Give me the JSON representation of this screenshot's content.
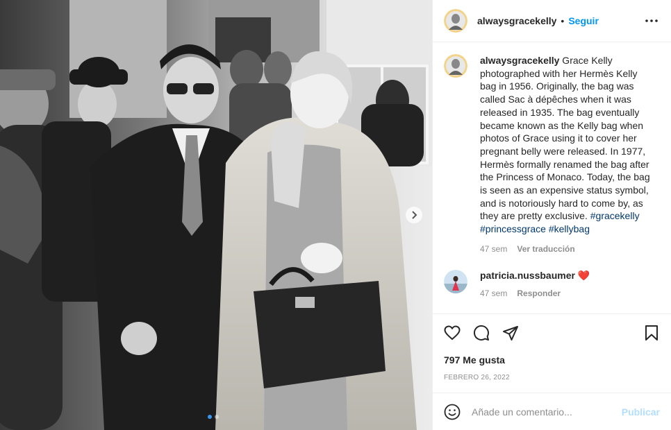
{
  "post": {
    "username": "alwaysgracekelly",
    "separator": "•",
    "follow_label": "Seguir"
  },
  "caption": {
    "username": "alwaysgracekelly",
    "text": " Grace Kelly photographed with her Hermès Kelly bag in 1956. Originally, the bag was called Sac à dépêches when it was released in 1935. The bag eventually became known as the Kelly bag when photos of Grace using it to cover her pregnant belly were released. In 1977, Hermès formally renamed the bag after the Princess of Monaco. Today, the bag is seen as an expensive status symbol, and is notoriously hard to come by, as they are pretty exclusive.",
    "hashtags": [
      "#gracekelly",
      "#princessgrace",
      "#kellybag"
    ],
    "time": "47 sem",
    "translate_label": "Ver traducción"
  },
  "comment": {
    "username": "patricia.nussbaumer",
    "emoji": "❤️",
    "time": "47 sem",
    "reply_label": "Responder"
  },
  "likes": "797 Me gusta",
  "date": "FEBRERO 26, 2022",
  "add_comment": {
    "placeholder": "Añade un comentario...",
    "publish_label": "Publicar"
  },
  "colors": {
    "accent": "#0095f6",
    "hashtag": "#00376b",
    "muted": "#8e8e8e",
    "publish_disabled": "#b2dffc",
    "heart": "#ed4956"
  },
  "carousel": {
    "slides": 2,
    "current": 1
  }
}
